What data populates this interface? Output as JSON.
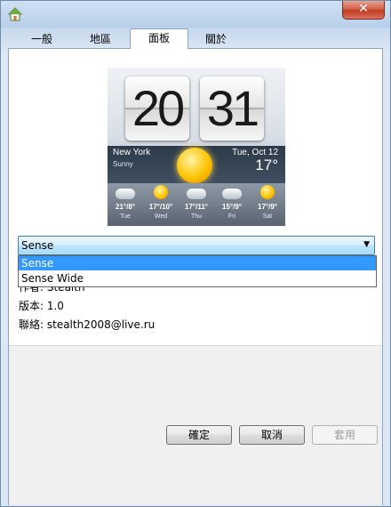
{
  "window": {
    "close_glyph": "✕",
    "icon": "home-icon"
  },
  "tabs": [
    {
      "label": "一般",
      "active": false
    },
    {
      "label": "地區",
      "active": false
    },
    {
      "label": "面板",
      "active": true
    },
    {
      "label": "關於",
      "active": false
    }
  ],
  "preview": {
    "hour": "20",
    "minute": "31",
    "city": "New York",
    "condition": "Sunny",
    "date": "Tue, Oct 12",
    "temp": "17°",
    "forecast": [
      {
        "temp": "21°/8°",
        "day": "Tue",
        "icon": "cloud"
      },
      {
        "temp": "17°/10°",
        "day": "Wed",
        "icon": "sun"
      },
      {
        "temp": "17°/11°",
        "day": "Thu",
        "icon": "cloud"
      },
      {
        "temp": "15°/9°",
        "day": "Fri",
        "icon": "cloud"
      },
      {
        "temp": "17°/9°",
        "day": "Sat",
        "icon": "sun"
      }
    ]
  },
  "skin_select": {
    "value": "Sense",
    "options": [
      "Sense",
      "Sense Wide"
    ],
    "highlighted": "Sense"
  },
  "info": {
    "author": "作者: Stealth",
    "version": "版本: 1.0",
    "contact": "聯絡: stealth2008@live.ru"
  },
  "buttons": {
    "ok": "確定",
    "cancel": "取消",
    "apply": "套用"
  },
  "colors": {
    "selection": "#3399ff",
    "combo_border": "#3c7fb1",
    "close_red": "#c33a22"
  }
}
